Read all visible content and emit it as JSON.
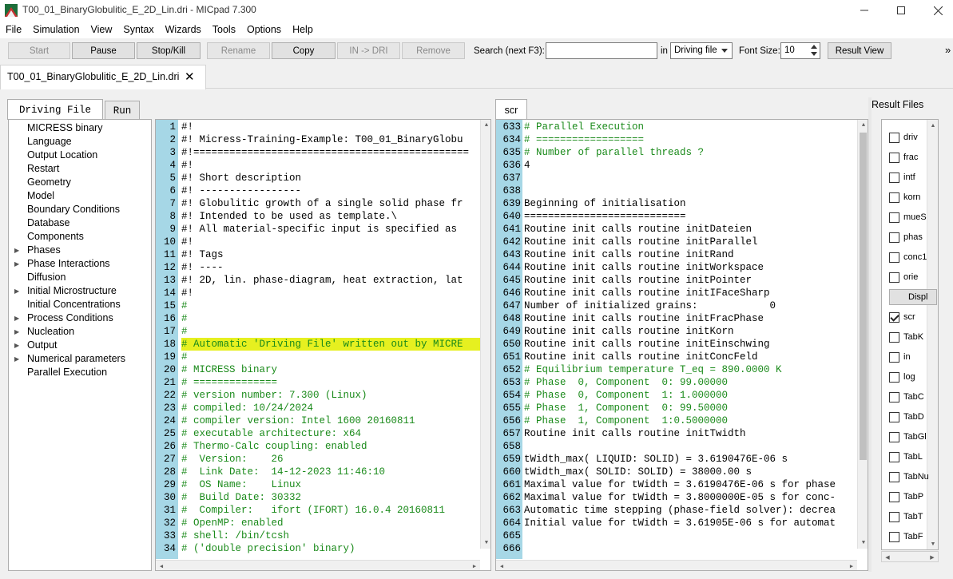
{
  "window": {
    "title": "T00_01_BinaryGlobulitic_E_2D_Lin.dri - MICpad 7.300"
  },
  "menu": [
    "File",
    "Simulation",
    "View",
    "Syntax",
    "Wizards",
    "Tools",
    "Options",
    "Help"
  ],
  "toolbar": {
    "start": "Start",
    "pause": "Pause",
    "stopkill": "Stop/Kill",
    "rename": "Rename",
    "copy": "Copy",
    "in_dri": "IN -> DRI",
    "remove": "Remove",
    "search_label": "Search (next F3):",
    "search_value": "",
    "in_label": "in",
    "search_scope": "Driving file",
    "font_size_label": "Font Size:",
    "font_size": "10",
    "result_view": "Result View",
    "overflow": "»"
  },
  "file_tab": {
    "label": "T00_01_BinaryGlobulitic_E_2D_Lin.dri"
  },
  "left_tabs": {
    "driving_file": "Driving File",
    "run": "Run"
  },
  "tree": [
    {
      "label": "MICRESS binary",
      "expandable": false
    },
    {
      "label": "Language",
      "expandable": false
    },
    {
      "label": "Output Location",
      "expandable": false
    },
    {
      "label": "Restart",
      "expandable": false
    },
    {
      "label": "Geometry",
      "expandable": false
    },
    {
      "label": "Model",
      "expandable": false
    },
    {
      "label": "Boundary Conditions",
      "expandable": false
    },
    {
      "label": "Database",
      "expandable": false
    },
    {
      "label": "Components",
      "expandable": false
    },
    {
      "label": "Phases",
      "expandable": true
    },
    {
      "label": "Phase Interactions",
      "expandable": true
    },
    {
      "label": "Diffusion",
      "expandable": false
    },
    {
      "label": "Initial Microstructure",
      "expandable": true
    },
    {
      "label": "Initial Concentrations",
      "expandable": false
    },
    {
      "label": "Process Conditions",
      "expandable": true
    },
    {
      "label": "Nucleation",
      "expandable": true
    },
    {
      "label": "Output",
      "expandable": true
    },
    {
      "label": "Numerical parameters",
      "expandable": true
    },
    {
      "label": "Parallel Execution",
      "expandable": false
    }
  ],
  "editor": {
    "lines": [
      {
        "n": "1",
        "text": "#!",
        "style": "plain"
      },
      {
        "n": "2",
        "text": "#! Micress-Training-Example: T00_01_BinaryGlobu",
        "style": "plain"
      },
      {
        "n": "3",
        "text": "#!==============================================",
        "style": "plain"
      },
      {
        "n": "4",
        "text": "#!",
        "style": "plain"
      },
      {
        "n": "5",
        "text": "#! Short description",
        "style": "plain"
      },
      {
        "n": "6",
        "text": "#! -----------------",
        "style": "plain"
      },
      {
        "n": "7",
        "text": "#! Globulitic growth of a single solid phase fr",
        "style": "plain"
      },
      {
        "n": "8",
        "text": "#! Intended to be used as template.\\",
        "style": "plain"
      },
      {
        "n": "9",
        "text": "#! All material-specific input is specified as ",
        "style": "plain"
      },
      {
        "n": "10",
        "text": "#!",
        "style": "plain"
      },
      {
        "n": "11",
        "text": "#! Tags",
        "style": "plain"
      },
      {
        "n": "12",
        "text": "#! ----",
        "style": "plain"
      },
      {
        "n": "13",
        "text": "#! 2D, lin. phase-diagram, heat extraction, lat",
        "style": "plain"
      },
      {
        "n": "14",
        "text": "#!",
        "style": "plain"
      },
      {
        "n": "15",
        "text": "#",
        "style": "green"
      },
      {
        "n": "16",
        "text": "#",
        "style": "green"
      },
      {
        "n": "17",
        "text": "#",
        "style": "green"
      },
      {
        "n": "18",
        "text": "# Automatic 'Driving File' written out by MICRE",
        "style": "highlight"
      },
      {
        "n": "19",
        "text": "#",
        "style": "green"
      },
      {
        "n": "20",
        "text": "# MICRESS binary",
        "style": "green"
      },
      {
        "n": "21",
        "text": "# ==============",
        "style": "green"
      },
      {
        "n": "22",
        "text": "# version number: 7.300 (Linux)",
        "style": "green"
      },
      {
        "n": "23",
        "text": "# compiled: 10/24/2024",
        "style": "green"
      },
      {
        "n": "24",
        "text": "# compiler version: Intel 1600 20160811",
        "style": "green"
      },
      {
        "n": "25",
        "text": "# executable architecture: x64",
        "style": "green"
      },
      {
        "n": "26",
        "text": "# Thermo-Calc coupling: enabled",
        "style": "green"
      },
      {
        "n": "27",
        "text": "#  Version:    26",
        "style": "green"
      },
      {
        "n": "28",
        "text": "#  Link Date:  14-12-2023 11:46:10",
        "style": "green"
      },
      {
        "n": "29",
        "text": "#  OS Name:    Linux",
        "style": "green"
      },
      {
        "n": "30",
        "text": "#  Build Date: 30332",
        "style": "green"
      },
      {
        "n": "31",
        "text": "#  Compiler:   ifort (IFORT) 16.0.4 20160811",
        "style": "green"
      },
      {
        "n": "32",
        "text": "# OpenMP: enabled",
        "style": "green"
      },
      {
        "n": "33",
        "text": "# shell: /bin/tcsh",
        "style": "green"
      },
      {
        "n": "34",
        "text": "# ('double precision' binary)",
        "style": "green"
      }
    ]
  },
  "scr_tab": {
    "label": "scr"
  },
  "scr": {
    "lines": [
      {
        "n": "633",
        "text": "# Parallel Execution",
        "style": "green"
      },
      {
        "n": "634",
        "text": "# ==================",
        "style": "green"
      },
      {
        "n": "635",
        "text": "# Number of parallel threads ?",
        "style": "green"
      },
      {
        "n": "636",
        "text": "4",
        "style": "plain"
      },
      {
        "n": "637",
        "text": "",
        "style": "plain"
      },
      {
        "n": "638",
        "text": "",
        "style": "plain"
      },
      {
        "n": "639",
        "text": "Beginning of initialisation",
        "style": "plain"
      },
      {
        "n": "640",
        "text": "===========================",
        "style": "plain"
      },
      {
        "n": "641",
        "text": "Routine init calls routine initDateien",
        "style": "plain"
      },
      {
        "n": "642",
        "text": "Routine init calls routine initParallel",
        "style": "plain"
      },
      {
        "n": "643",
        "text": "Routine init calls routine initRand",
        "style": "plain"
      },
      {
        "n": "644",
        "text": "Routine init calls routine initWorkspace",
        "style": "plain"
      },
      {
        "n": "645",
        "text": "Routine init calls routine initPointer",
        "style": "plain"
      },
      {
        "n": "646",
        "text": "Routine init calls routine initIFaceSharp",
        "style": "plain"
      },
      {
        "n": "647",
        "text": "Number of initialized grains:            0",
        "style": "plain"
      },
      {
        "n": "648",
        "text": "Routine init calls routine initFracPhase",
        "style": "plain"
      },
      {
        "n": "649",
        "text": "Routine init calls routine initKorn",
        "style": "plain"
      },
      {
        "n": "650",
        "text": "Routine init calls routine initEinschwing",
        "style": "plain"
      },
      {
        "n": "651",
        "text": "Routine init calls routine initConcFeld",
        "style": "plain"
      },
      {
        "n": "652",
        "text": "# Equilibrium temperature T_eq = 890.0000 K",
        "style": "green"
      },
      {
        "n": "653",
        "text": "# Phase  0, Component  0: 99.00000",
        "style": "green"
      },
      {
        "n": "654",
        "text": "# Phase  0, Component  1: 1.000000",
        "style": "green"
      },
      {
        "n": "655",
        "text": "# Phase  1, Component  0: 99.50000",
        "style": "green"
      },
      {
        "n": "656",
        "text": "# Phase  1, Component  1:0.5000000",
        "style": "green"
      },
      {
        "n": "657",
        "text": "Routine init calls routine initTwidth",
        "style": "plain"
      },
      {
        "n": "658",
        "text": "",
        "style": "plain"
      },
      {
        "n": "659",
        "text": "tWidth_max( LIQUID: SOLID) = 3.6190476E-06 s",
        "style": "plain"
      },
      {
        "n": "660",
        "text": "tWidth_max( SOLID: SOLID) = 38000.00 s",
        "style": "plain"
      },
      {
        "n": "661",
        "text": "Maximal value for tWidth = 3.6190476E-06 s for phase",
        "style": "plain"
      },
      {
        "n": "662",
        "text": "Maximal value for tWidth = 3.8000000E-05 s for conc-",
        "style": "plain"
      },
      {
        "n": "663",
        "text": "Automatic time stepping (phase-field solver): decrea",
        "style": "plain"
      },
      {
        "n": "664",
        "text": "Initial value for tWidth = 3.61905E-06 s for automat",
        "style": "plain"
      },
      {
        "n": "665",
        "text": "",
        "style": "plain"
      },
      {
        "n": "666",
        "text": "",
        "style": "plain"
      }
    ]
  },
  "result_files": {
    "title": "Result Files",
    "items": [
      {
        "label": "driv",
        "type": "checkbox",
        "checked": false
      },
      {
        "label": "frac",
        "type": "checkbox",
        "checked": false
      },
      {
        "label": "intf",
        "type": "checkbox",
        "checked": false
      },
      {
        "label": "korn",
        "type": "checkbox",
        "checked": false
      },
      {
        "label": "mueS",
        "type": "checkbox",
        "checked": false
      },
      {
        "label": "phas",
        "type": "checkbox",
        "checked": false
      },
      {
        "label": "conc1",
        "type": "checkbox",
        "checked": false
      },
      {
        "label": "orie",
        "type": "checkbox",
        "checked": false
      },
      {
        "label": "Displ",
        "type": "button"
      },
      {
        "label": "scr",
        "type": "checkbox",
        "checked": true
      },
      {
        "label": "TabK",
        "type": "checkbox",
        "checked": false
      },
      {
        "label": "in",
        "type": "checkbox",
        "checked": false
      },
      {
        "label": "log",
        "type": "checkbox",
        "checked": false
      },
      {
        "label": "TabC",
        "type": "checkbox",
        "checked": false
      },
      {
        "label": "TabD",
        "type": "checkbox",
        "checked": false
      },
      {
        "label": "TabGl",
        "type": "checkbox",
        "checked": false
      },
      {
        "label": "TabL",
        "type": "checkbox",
        "checked": false
      },
      {
        "label": "TabNu",
        "type": "checkbox",
        "checked": false
      },
      {
        "label": "TabP",
        "type": "checkbox",
        "checked": false
      },
      {
        "label": "TabT",
        "type": "checkbox",
        "checked": false
      },
      {
        "label": "TabF",
        "type": "checkbox",
        "checked": false
      }
    ]
  }
}
